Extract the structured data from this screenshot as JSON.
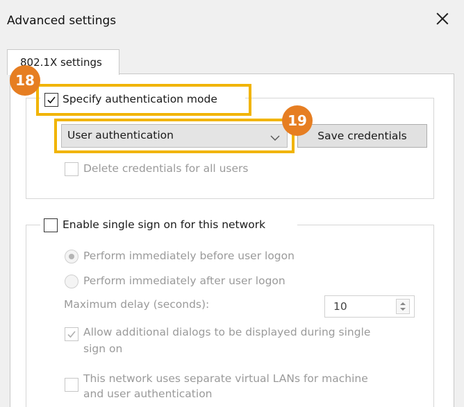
{
  "dialog": {
    "title": "Advanced settings",
    "close_icon": "close-icon"
  },
  "tabs": [
    {
      "label": "802.1X settings",
      "selected": true
    }
  ],
  "auth_group": {
    "specify_mode": {
      "label": "Specify authentication mode",
      "checked": true
    },
    "mode_select": {
      "value": "User authentication",
      "icon": "chevron-down-icon"
    },
    "save_credentials_label": "Save credentials",
    "delete_credentials": {
      "label": "Delete credentials for all users",
      "checked": false,
      "enabled": false
    }
  },
  "sso_group": {
    "enable_sso": {
      "label": "Enable single sign on for this network",
      "checked": false
    },
    "perform_before": {
      "label": "Perform immediately before user logon",
      "selected": true,
      "enabled": false
    },
    "perform_after": {
      "label": "Perform immediately after user logon",
      "selected": false,
      "enabled": false
    },
    "max_delay": {
      "label": "Maximum delay (seconds):",
      "value": "10"
    },
    "allow_dialogs": {
      "label_line1": "Allow additional dialogs to be displayed during single",
      "label_line2": "sign on",
      "checked": true,
      "enabled": false
    },
    "separate_vlans": {
      "label_line1": "This network uses separate virtual LANs for machine",
      "label_line2": "and user authentication",
      "checked": false,
      "enabled": false
    }
  },
  "annotations": {
    "badge_18": "18",
    "badge_19": "19",
    "highlight_color": "#f1b400",
    "badge_color": "#e67e22"
  }
}
